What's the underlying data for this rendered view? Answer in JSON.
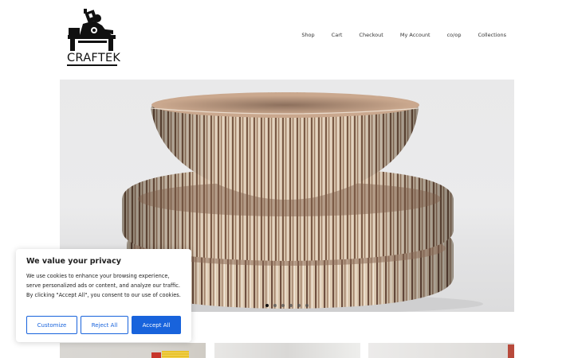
{
  "header": {
    "logo_text": "CRAFTEK",
    "nav": [
      "Shop",
      "Cart",
      "Checkout",
      "My Account",
      "co/op",
      "Collections"
    ]
  },
  "hero": {
    "slide_count": 6,
    "active_slide": 1
  },
  "cookie_banner": {
    "title": "We value your privacy",
    "body": "We use cookies to enhance your browsing experience, serve personalized ads or content, and analyze our traffic. By clicking \"Accept All\", you consent to our use of cookies.",
    "customize_label": "Customize",
    "reject_label": "Reject All",
    "accept_label": "Accept All",
    "accent_color": "#1863dc"
  }
}
